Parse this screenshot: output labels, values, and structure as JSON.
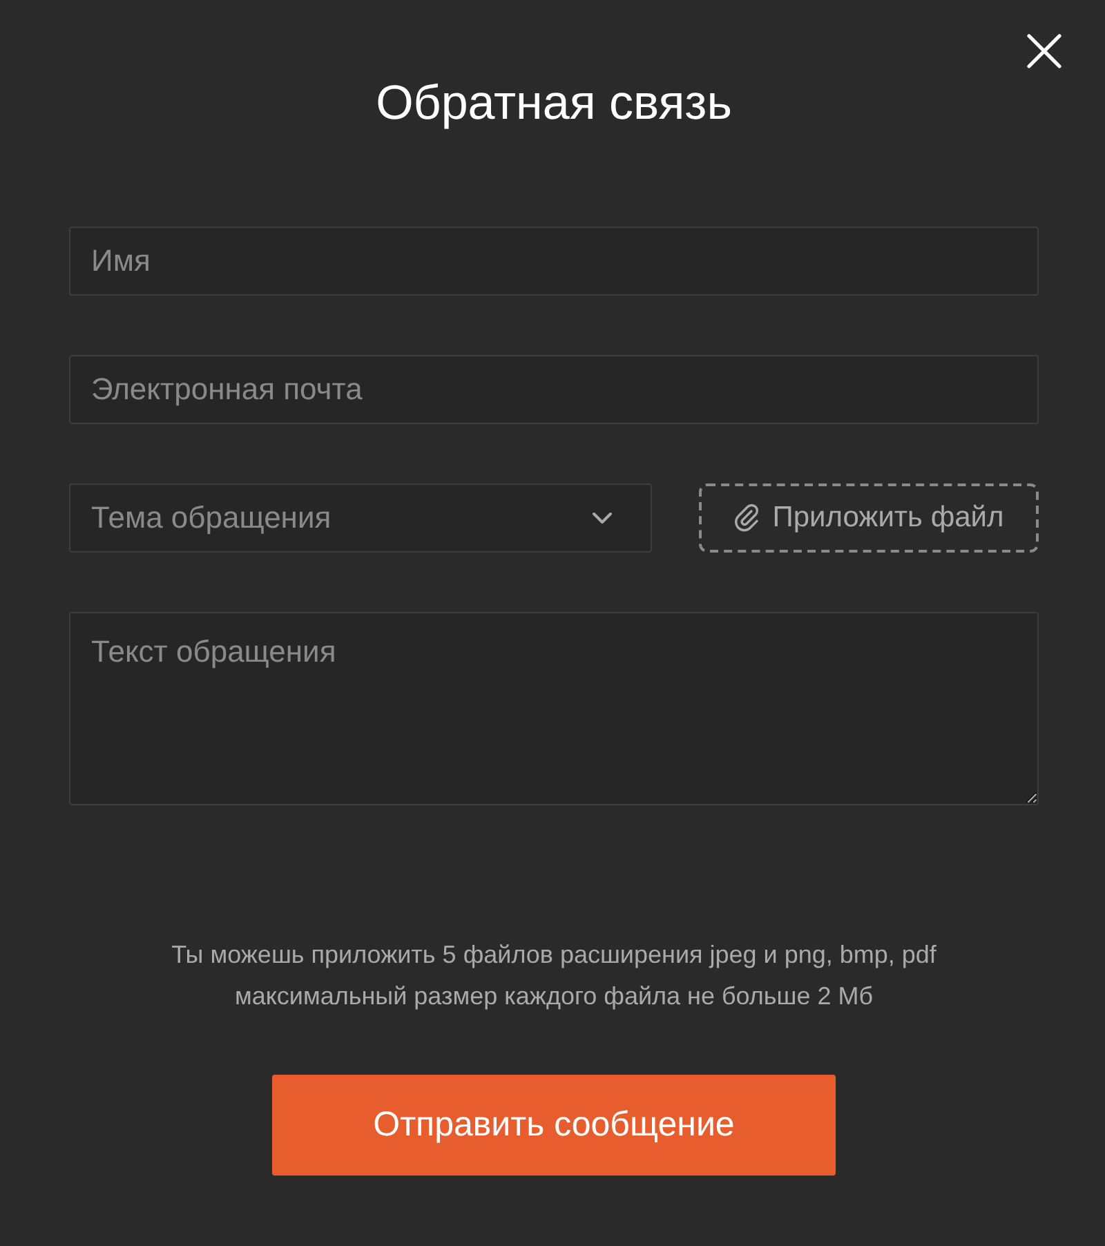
{
  "dialog": {
    "title": "Обратная связь"
  },
  "fields": [
    {
      "kind": "text",
      "placeholder": "Имя"
    },
    {
      "kind": "text",
      "placeholder": "Электронная почта"
    },
    {
      "kind": "select",
      "placeholder": "Тема обращения"
    },
    {
      "kind": "textarea",
      "placeholder": "Текст обращения"
    }
  ],
  "attach_button": {
    "label": "Приложить файл"
  },
  "note": [
    "Ты можешь приложить 5 файлов расширения jpeg и png, bmp, pdf",
    "максимальный размер каждого файла не больше 2 Мб"
  ],
  "submit_button": {
    "label": "Отправить сообщение"
  }
}
